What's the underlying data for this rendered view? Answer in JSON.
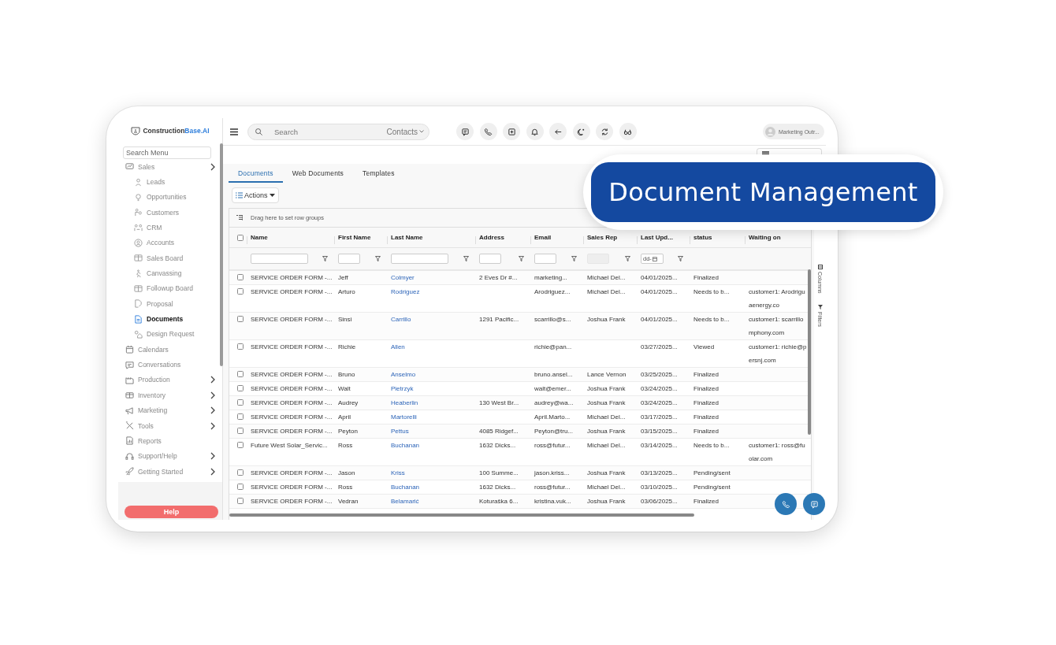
{
  "banner": {
    "title": "Document Management"
  },
  "logo": {
    "name": "Construction",
    "accent": "Base.AI"
  },
  "sidebar": {
    "search_placeholder": "Search Menu",
    "items": [
      {
        "label": "Sales",
        "selected": false,
        "submenu": true,
        "children": [
          {
            "label": "Leads",
            "selected": false
          },
          {
            "label": "Opportunities",
            "selected": false
          },
          {
            "label": "Customers",
            "selected": false
          },
          {
            "label": "CRM",
            "selected": false
          },
          {
            "label": "Accounts",
            "selected": false
          },
          {
            "label": "Sales Board",
            "selected": false
          },
          {
            "label": "Canvassing",
            "selected": false
          },
          {
            "label": "Followup Board",
            "selected": false
          },
          {
            "label": "Proposal",
            "selected": false
          },
          {
            "label": "Documents",
            "selected": true
          },
          {
            "label": "Design Request",
            "selected": false
          }
        ]
      },
      {
        "label": "Calendars",
        "selected": false,
        "submenu": false
      },
      {
        "label": "Conversations",
        "selected": false,
        "submenu": false
      },
      {
        "label": "Production",
        "selected": false,
        "submenu": true
      },
      {
        "label": "Inventory",
        "selected": false,
        "submenu": true
      },
      {
        "label": "Marketing",
        "selected": false,
        "submenu": true
      },
      {
        "label": "Tools",
        "selected": false,
        "submenu": true
      },
      {
        "label": "Reports",
        "selected": false,
        "submenu": false
      },
      {
        "label": "Support/Help",
        "selected": false,
        "submenu": true
      },
      {
        "label": "Getting Started",
        "selected": false,
        "submenu": true
      }
    ],
    "help_button": "Help"
  },
  "topbar": {
    "search_placeholder": "Search",
    "search_scope": "Contacts",
    "user": "Marketing Outr..."
  },
  "tabs": [
    {
      "label": "Documents",
      "selected": true
    },
    {
      "label": "Web Documents",
      "selected": false
    },
    {
      "label": "Templates",
      "selected": false
    }
  ],
  "actions_button": "Actions",
  "row_group_hint": "Drag here to set row groups",
  "side_panel": [
    "Columns",
    "Filters"
  ],
  "table": {
    "select_all_checked": false,
    "columns": [
      {
        "label": "Name",
        "kind": "text",
        "filter": {
          "kind": "text",
          "disabled": false
        }
      },
      {
        "label": "First Name",
        "kind": "text",
        "filter": {
          "kind": "text",
          "disabled": false
        }
      },
      {
        "label": "Last Name",
        "kind": "link",
        "filter": {
          "kind": "text",
          "disabled": false
        }
      },
      {
        "label": "Address",
        "kind": "text",
        "filter": {
          "kind": "text",
          "disabled": false
        }
      },
      {
        "label": "Email",
        "kind": "text",
        "filter": {
          "kind": "text",
          "disabled": false
        }
      },
      {
        "label": "Sales Rep",
        "kind": "text",
        "filter": {
          "kind": "text",
          "disabled": true
        }
      },
      {
        "label": "Last Upd...",
        "kind": "text",
        "filter": {
          "kind": "date",
          "disabled": false,
          "value": "dd-"
        }
      },
      {
        "label": "status",
        "kind": "text"
      },
      {
        "label": "Waiting on",
        "kind": "text"
      }
    ],
    "rows": [
      {
        "checked": false,
        "cells": [
          "SERVICE ORDER FORM -...",
          "Jeff",
          "Colmyer",
          "2 Eves Dr #...",
          "marketing...",
          "Michael Del...",
          "04/01/2025...",
          "Finalized",
          ""
        ]
      },
      {
        "checked": false,
        "cells": [
          "SERVICE ORDER FORM -...",
          "Arturo",
          "Rodriguez",
          "",
          "Arodriguez...",
          "Michael Del...",
          "04/01/2025...",
          "Needs to b...",
          "customer1: Arodrigu\naenergy.co"
        ]
      },
      {
        "checked": false,
        "cells": [
          "SERVICE ORDER FORM -...",
          "Sinsi",
          "Carrillo",
          "1291 Pacific...",
          "scarrillo@s...",
          "Joshua Frank",
          "04/01/2025...",
          "Needs to b...",
          "customer1: scarrillo\nmphony.com"
        ]
      },
      {
        "checked": false,
        "cells": [
          "SERVICE ORDER FORM -...",
          "Richie",
          "Allen",
          "",
          "richie@pan...",
          "",
          "03/27/2025...",
          "Viewed",
          "customer1: richie@p\nersnj.com"
        ]
      },
      {
        "checked": false,
        "cells": [
          "SERVICE ORDER FORM -...",
          "Bruno",
          "Anselmo",
          "",
          "bruno.ansel...",
          "Lance Vernon",
          "03/25/2025...",
          "Finalized",
          ""
        ]
      },
      {
        "checked": false,
        "cells": [
          "SERVICE ORDER FORM -...",
          "Walt",
          "Pietrzyk",
          "",
          "walt@emer...",
          "Joshua Frank",
          "03/24/2025...",
          "Finalized",
          ""
        ]
      },
      {
        "checked": false,
        "cells": [
          "SERVICE ORDER FORM -...",
          "Audrey",
          "Heaberlin",
          "130 West Br...",
          "audrey@wa...",
          "Joshua Frank",
          "03/24/2025...",
          "Finalized",
          ""
        ]
      },
      {
        "checked": false,
        "cells": [
          "SERVICE ORDER FORM -...",
          "April",
          "Martorelli",
          "",
          "April.Marto...",
          "Michael Del...",
          "03/17/2025...",
          "Finalized",
          ""
        ]
      },
      {
        "checked": false,
        "cells": [
          "SERVICE ORDER FORM -...",
          "Peyton",
          "Pettus",
          "4085 Ridgef...",
          "Peyton@tru...",
          "Joshua Frank",
          "03/15/2025...",
          "Finalized",
          ""
        ]
      },
      {
        "checked": false,
        "cells": [
          "Future West Solar_Servic...",
          "Ross",
          "Buchanan",
          "1632 Dicks...",
          "ross@futur...",
          "Michael Del...",
          "03/14/2025...",
          "Needs to b...",
          "customer1: ross@fu\nolar.com"
        ]
      },
      {
        "checked": false,
        "cells": [
          "SERVICE ORDER FORM -...",
          "Jason",
          "Kriss",
          "100 Summe...",
          "jason.kriss...",
          "Joshua Frank",
          "03/13/2025...",
          "Pending/sent",
          ""
        ]
      },
      {
        "checked": false,
        "cells": [
          "SERVICE ORDER FORM -...",
          "Ross",
          "Buchanan",
          "1632 Dicks...",
          "ross@futur...",
          "Michael Del...",
          "03/10/2025...",
          "Pending/sent",
          ""
        ]
      },
      {
        "checked": false,
        "cells": [
          "SERVICE ORDER FORM -...",
          "Vedran",
          "Belamarić",
          "Koturaška 6...",
          "kristina.vuk...",
          "Joshua Frank",
          "03/06/2025...",
          "Finalized",
          ""
        ]
      }
    ]
  }
}
